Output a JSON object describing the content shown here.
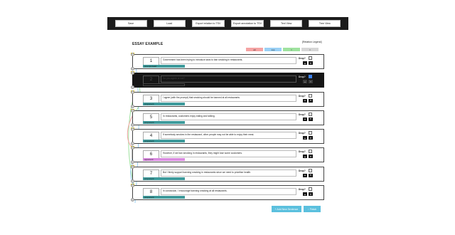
{
  "toolbar": {
    "buttons": [
      "Save",
      "Load",
      "Export relation to TSV",
      "Export annotation to TSV",
      "Text View",
      "Tree View"
    ]
  },
  "essay_title": "ESSAY EXAMPLE",
  "legend": {
    "label": "[Relation Legend]",
    "items": [
      {
        "label": "att",
        "color": "#f5a3a3"
      },
      {
        "label": "sup",
        "color": "#9ad0f5"
      },
      {
        "label": "=",
        "color": "#9fe29f"
      },
      {
        "label": "=",
        "color": "#d6d6d6"
      }
    ]
  },
  "drop_label": "Drop?",
  "up_arrow": "▲",
  "down_arrow": "▼",
  "sentences": [
    {
      "num": "1",
      "text": "Government has been trying to introduce laws to ban smoking in restaurants.",
      "tag": "prompt-head",
      "dark": false,
      "dropped": false
    },
    {
      "num": "2",
      "text": "Do you agree or not?",
      "tag": "",
      "dark": true,
      "dropped": true
    },
    {
      "num": "3",
      "text": "I agree (with the prompt) that smoking should be banned at all restaurants.",
      "tag": "proponent",
      "dark": false,
      "dropped": false
    },
    {
      "num": "5",
      "text": "In restaurants, customers enjoy eating and talking.",
      "tag": "proponent",
      "dark": false,
      "dropped": false
    },
    {
      "num": "4",
      "text": "If somebody smokes in the restaurant, other people may not be able to enjoy their meal.",
      "tag": "proponent",
      "dark": false,
      "dropped": false
    },
    {
      "num": "6",
      "text": "However, if we ban smoking in restaurants, they might lose some customers.",
      "tag": "opponent",
      "dark": false,
      "dropped": false
    },
    {
      "num": "7",
      "text": "But I firmly support banning smoking in restaurants since we need to prioritise health.",
      "tag": "proponent",
      "dark": false,
      "dropped": false
    },
    {
      "num": "8",
      "text": "In conclusion, I encourage banning smoking at all restaurants.",
      "tag": "proponent",
      "dark": false,
      "dropped": false
    }
  ],
  "bottom_buttons": {
    "add": "+ Add New Sentence",
    "finish": "↑ Finish"
  },
  "colors": {
    "teal": "#3d9a9b",
    "violet": "#d98be0",
    "accent": "#5bc0de"
  }
}
